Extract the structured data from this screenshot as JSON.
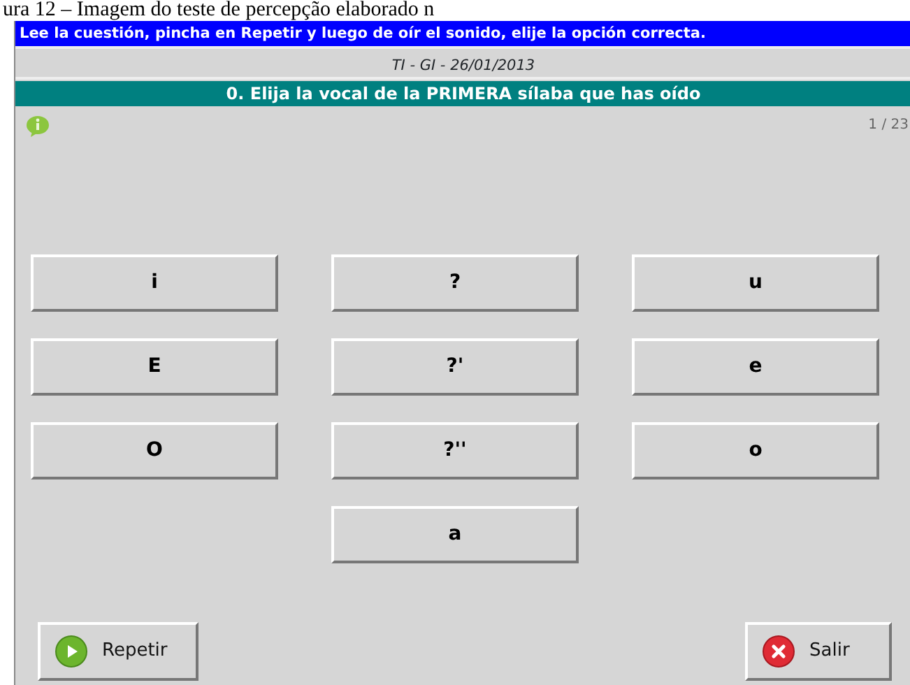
{
  "caption": "ura 12 – Imagem do teste de percepção elaborado n",
  "instruction": "Lee la cuestión, pincha en Repetir y luego de oír el sonido, elije la opción correcta.",
  "subtitle": "TI - GI - 26/01/2013",
  "question": "0. Elija la vocal de la PRIMERA sílaba que has oído",
  "counter": "1 / 23",
  "option_rows": [
    [
      "i",
      "?",
      "u"
    ],
    [
      "E",
      "?'",
      "e"
    ],
    [
      "O",
      "?''",
      "o"
    ],
    [
      "a"
    ]
  ],
  "buttons": [
    {
      "label": "Repetir",
      "kind": "play"
    },
    {
      "label": "Salir",
      "kind": "exit"
    }
  ]
}
